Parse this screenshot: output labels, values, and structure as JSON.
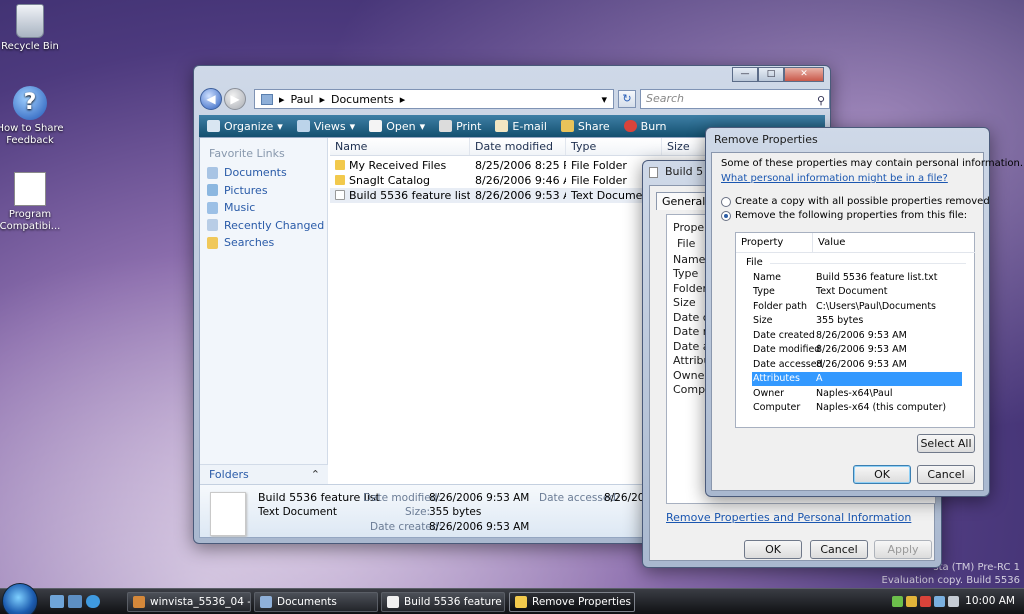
{
  "desktop": {
    "icons": [
      {
        "label": "Recycle Bin"
      },
      {
        "label": "How to Share Feedback"
      },
      {
        "label": "Program Compatibi..."
      }
    ],
    "watermark_line1": "sta (TM) Pre-RC 1",
    "watermark_line2": "Evaluation copy. Build 5536"
  },
  "explorer": {
    "breadcrumb": [
      "Paul",
      "Documents"
    ],
    "search_placeholder": "Search",
    "toolbar": [
      "Organize",
      "Views",
      "Open",
      "Print",
      "E-mail",
      "Share",
      "Burn"
    ],
    "nav_header": "Favorite Links",
    "nav_links": [
      "Documents",
      "Pictures",
      "Music",
      "Recently Changed",
      "Searches"
    ],
    "folders_label": "Folders",
    "columns": [
      "Name",
      "Date modified",
      "Type",
      "Size"
    ],
    "files": [
      {
        "name": "My Received Files",
        "date": "8/25/2006 8:25 PM",
        "type": "File Folder"
      },
      {
        "name": "SnagIt Catalog",
        "date": "8/26/2006 9:46 AM",
        "type": "File Folder"
      },
      {
        "name": "Build 5536 feature list",
        "date": "8/26/2006 9:53 AM",
        "type": "Text Document"
      }
    ],
    "details": {
      "name": "Build 5536 feature list",
      "type": "Text Document",
      "date_modified_label": "Date modified:",
      "date_modified": "8/26/2006 9:53 AM",
      "size_label": "Size:",
      "size": "355 bytes",
      "date_created_label": "Date created:",
      "date_created": "8/26/2006 9:53 AM",
      "date_accessed_label": "Date accessed:",
      "date_accessed": "8/26/200"
    }
  },
  "props_window": {
    "title": "Build 5",
    "tab": "General",
    "tab2": "S",
    "header": "Property",
    "section": "File",
    "labels": [
      "Name",
      "Type",
      "Folder pa",
      "Size",
      "Date crea",
      "Date modi",
      "Date acce",
      "Attributes",
      "Owner",
      "Compute"
    ],
    "link": "Remove Properties and Personal Information",
    "ok": "OK",
    "cancel": "Cancel",
    "apply": "Apply"
  },
  "remove_dialog": {
    "title": "Remove Properties",
    "intro": "Some of these properties may contain personal information.",
    "link": "What personal information might be in a file?",
    "option1": "Create a copy with all possible properties removed",
    "option2": "Remove the following properties from this file:",
    "col_property": "Property",
    "col_value": "Value",
    "section": "File",
    "rows": [
      {
        "property": "Name",
        "value": "Build 5536 feature list.txt"
      },
      {
        "property": "Type",
        "value": "Text Document"
      },
      {
        "property": "Folder path",
        "value": "C:\\Users\\Paul\\Documents"
      },
      {
        "property": "Size",
        "value": "355 bytes"
      },
      {
        "property": "Date created",
        "value": "8/26/2006 9:53 AM"
      },
      {
        "property": "Date modified",
        "value": "8/26/2006 9:53 AM"
      },
      {
        "property": "Date accessed",
        "value": "8/26/2006 9:53 AM"
      },
      {
        "property": "Attributes",
        "value": "A"
      },
      {
        "property": "Owner",
        "value": "Naples-x64\\Paul"
      },
      {
        "property": "Computer",
        "value": "Naples-x64 (this computer)"
      }
    ],
    "select_all": "Select All",
    "ok": "OK",
    "cancel": "Cancel"
  },
  "taskbar": {
    "tasks": [
      "winvista_5536_04 - P...",
      "Documents",
      "Build 5536 feature li...",
      "Remove Properties"
    ],
    "clock": "10:00 AM"
  }
}
